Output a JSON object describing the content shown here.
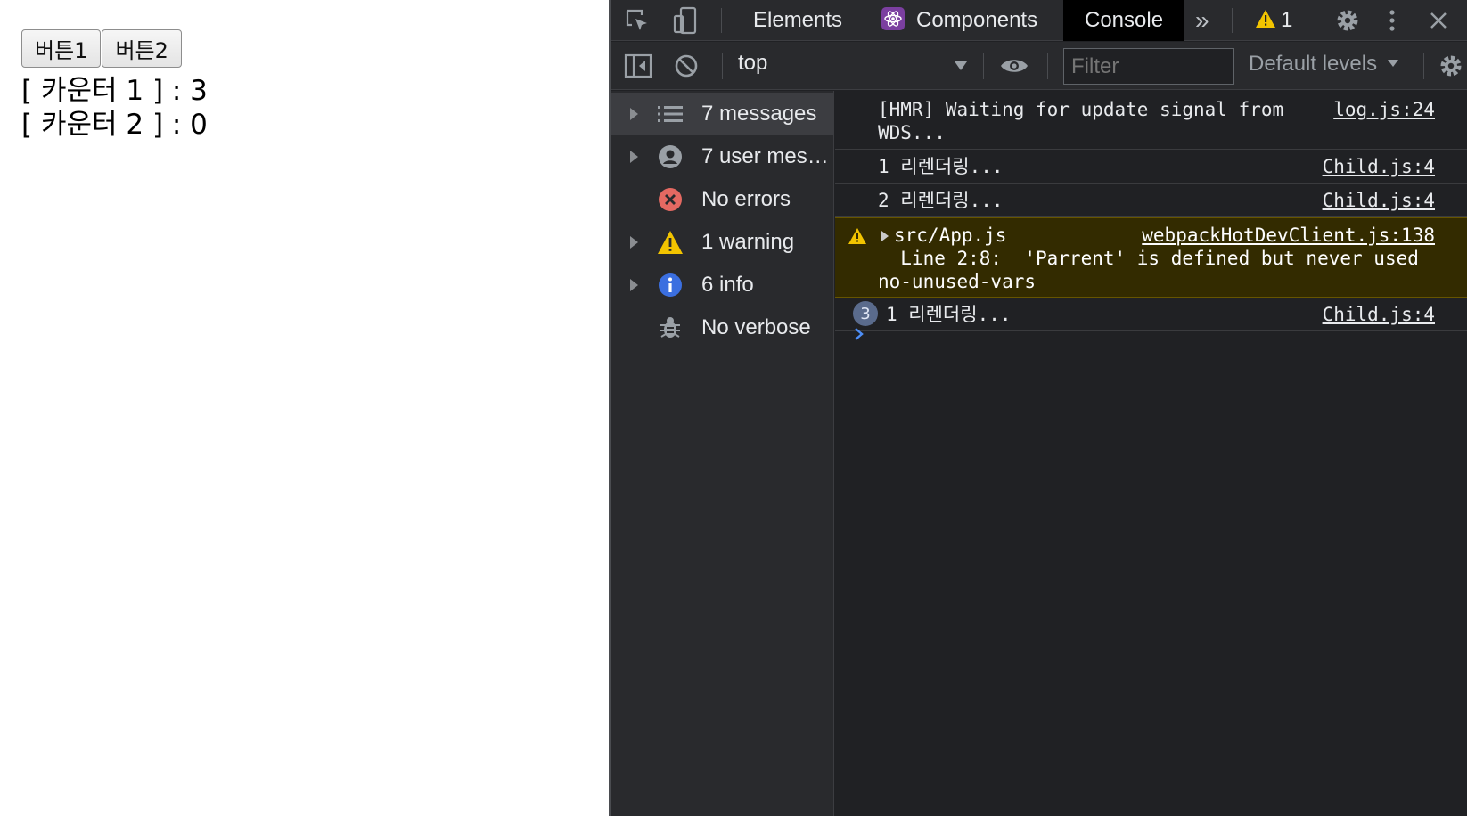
{
  "page": {
    "buttons": [
      "버튼1",
      "버튼2"
    ],
    "counters": [
      "[ 카운터 1 ] : 3",
      "[ 카운터 2 ] : 0"
    ]
  },
  "devtools": {
    "tabs": {
      "elements": "Elements",
      "components": "Components",
      "console": "Console",
      "more": "»",
      "warning_count": "1"
    },
    "toolbar": {
      "context": "top",
      "filter_placeholder": "Filter",
      "levels": "Default levels"
    },
    "sidebar": [
      {
        "label": "7 messages",
        "icon": "list-icon",
        "expandable": true,
        "selected": true
      },
      {
        "label": "7 user mes…",
        "icon": "user-icon",
        "expandable": true,
        "selected": false
      },
      {
        "label": "No errors",
        "icon": "error-icon",
        "expandable": false,
        "selected": false
      },
      {
        "label": "1 warning",
        "icon": "warning-icon",
        "expandable": true,
        "selected": false
      },
      {
        "label": "6 info",
        "icon": "info-icon",
        "expandable": true,
        "selected": false
      },
      {
        "label": "No verbose",
        "icon": "bug-icon",
        "expandable": false,
        "selected": false
      }
    ],
    "messages": [
      {
        "text": "[HMR] Waiting for update signal from\nWDS...",
        "source": "log.js:24"
      },
      {
        "text": "1 리렌더링...",
        "source": "Child.js:4"
      },
      {
        "text": "2 리렌더링...",
        "source": "Child.js:4"
      },
      {
        "text": "src/App.js\n  Line 2:8:  'Parrent' is defined but never used\nno-unused-vars",
        "source": "webpackHotDevClient.js:138",
        "level": "warning"
      },
      {
        "text": "1 리렌더링...",
        "source": "Child.js:4",
        "count": "3"
      }
    ],
    "colors": {
      "accent": "#4d8ef7",
      "warning": "#f2c400",
      "error": "#e46962",
      "info": "#3b6fe0"
    }
  }
}
